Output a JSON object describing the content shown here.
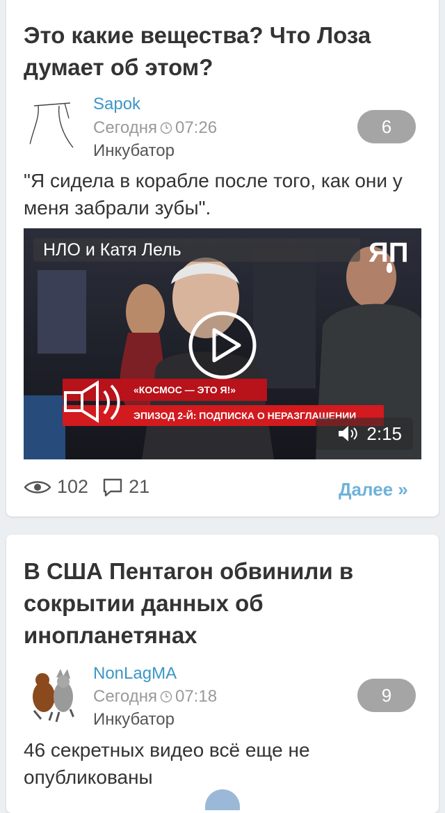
{
  "posts": [
    {
      "title": "Это какие вещества? Что Лоза думает об этом?",
      "author": "Sapok",
      "date_label": "Сегодня",
      "time": "07:26",
      "community": "Инкубатор",
      "comments_count": "6",
      "excerpt": "\"Я сидела в корабле после того, как они у меня забрали зубы\".",
      "video": {
        "title": "НЛО и Катя Лель",
        "channel_logo_text": "ЯП",
        "duration": "2:15",
        "caption_top": "«КОСМОС — ЭТО Я!»",
        "caption_bottom": "ЭПИЗОД 2-Й: ПОДПИСКА О НЕРАЗГЛАШЕНИИ"
      },
      "views": "102",
      "comments": "21",
      "more_label": "Далее »"
    },
    {
      "title": "В США Пентагон обвинили в сокрытии данных об инопланетянах",
      "author": "NonLagMA",
      "date_label": "Сегодня",
      "time": "07:18",
      "community": "Инкубатор",
      "comments_count": "9",
      "excerpt": "46 секретных видео всё еще не опубликованы"
    }
  ],
  "colors": {
    "author": "#3b96c6",
    "badge": "#a5a5a5",
    "more": "#6fb2d9",
    "background": "#eceff1"
  }
}
